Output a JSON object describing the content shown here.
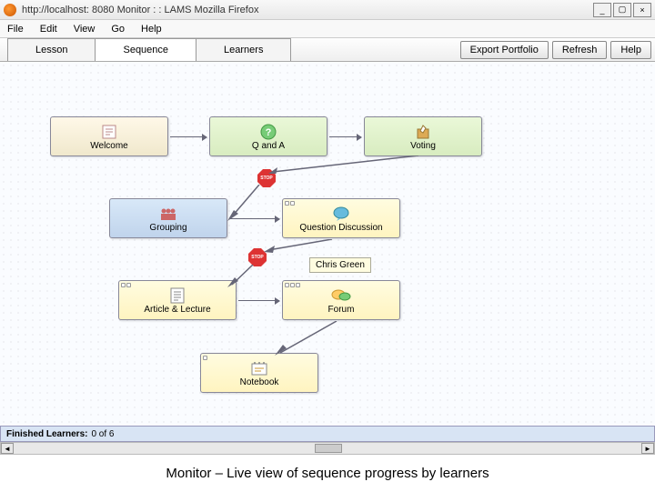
{
  "window": {
    "url_title": "http://localhost: 8080   Monitor : : LAMS   Mozilla Firefox",
    "min": "_",
    "max": "▢",
    "close": "×"
  },
  "menu": {
    "file": "File",
    "edit": "Edit",
    "view": "View",
    "go": "Go",
    "help": "Help"
  },
  "tabs": {
    "lesson": "Lesson",
    "sequence": "Sequence",
    "learners": "Learners"
  },
  "buttons": {
    "export": "Export Portfolio",
    "refresh": "Refresh",
    "help": "Help"
  },
  "nodes": {
    "welcome": "Welcome",
    "qanda": "Q and A",
    "voting": "Voting",
    "grouping": "Grouping",
    "question_discussion": "Question Discussion",
    "article_lecture": "Article & Lecture",
    "forum": "Forum",
    "notebook": "Notebook"
  },
  "badges": {
    "chris": "Chris Green"
  },
  "stop": {
    "label": "STOP"
  },
  "status": {
    "label": "Finished Learners:",
    "value": "0 of 6"
  },
  "caption": "Monitor – Live view of sequence progress by learners"
}
